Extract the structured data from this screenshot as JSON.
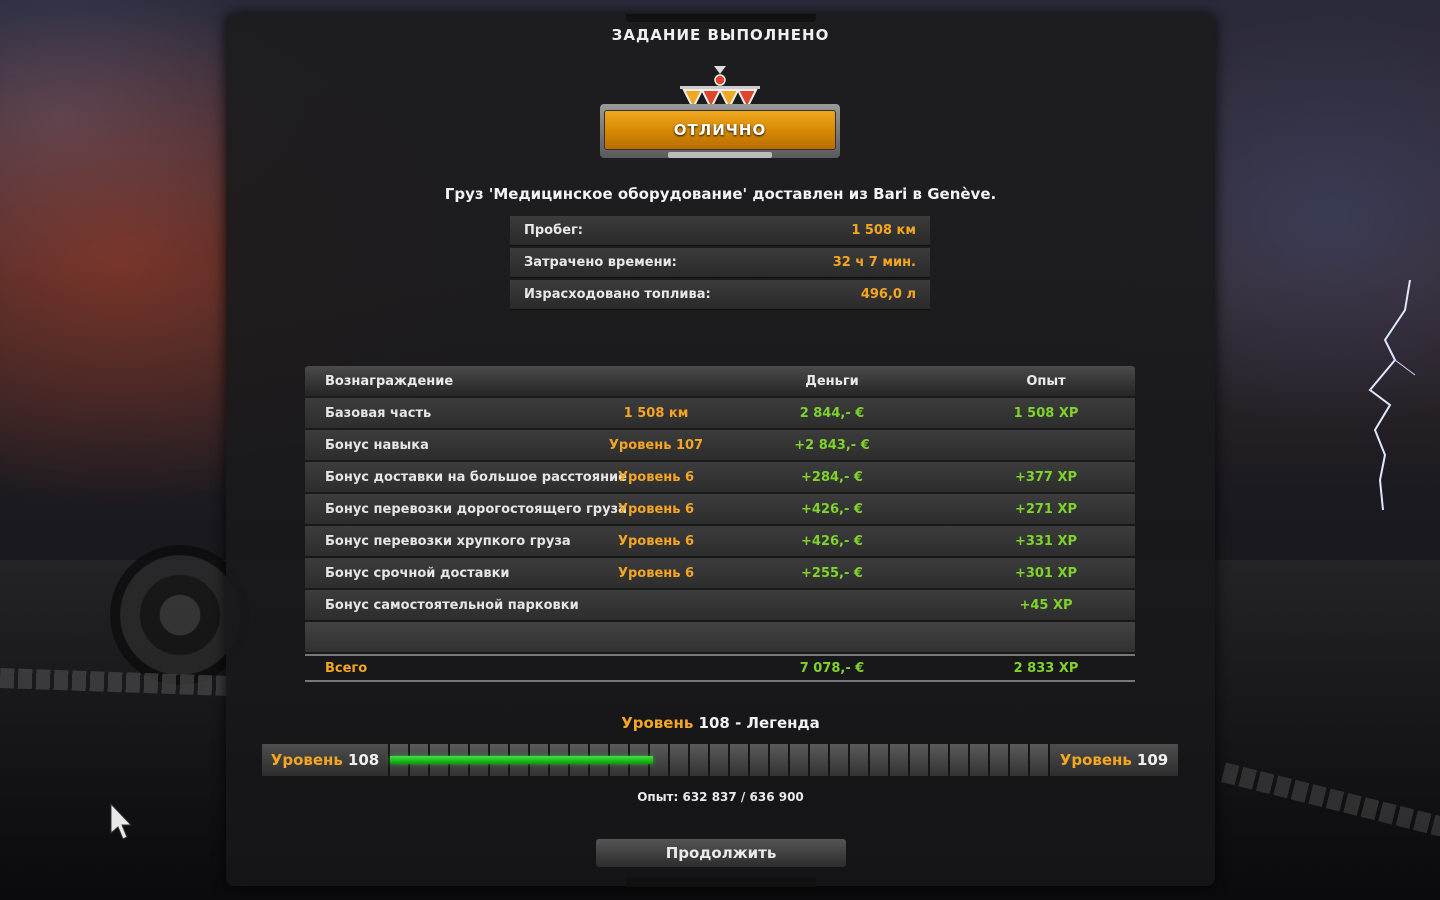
{
  "window": {
    "title": "ЗАДАНИЕ ВЫПОЛНЕНО"
  },
  "rating": {
    "label": "ОТЛИЧНО",
    "color": "#f0a81e"
  },
  "cargo_text": "Груз 'Медицинское оборудование' доставлен из Bari в Genève.",
  "stats": [
    {
      "label": "Пробег:",
      "value": "1 508 км"
    },
    {
      "label": "Затрачено времени:",
      "value": "32 ч 7 мин."
    },
    {
      "label": "Израсходовано топлива:",
      "value": "496,0 л"
    }
  ],
  "rewards": {
    "headers": {
      "name": "Вознаграждение",
      "money": "Деньги",
      "xp": "Опыт"
    },
    "rows": [
      {
        "name": "Базовая часть",
        "mid": "1 508 км",
        "money": "2 844,- €",
        "xp": "1 508 XP"
      },
      {
        "name": "Бонус навыка",
        "mid": "Уровень 107",
        "money": "+2 843,- €",
        "xp": ""
      },
      {
        "name": "Бонус доставки на большое расстояние",
        "mid": "Уровень 6",
        "money": "+284,- €",
        "xp": "+377 XP"
      },
      {
        "name": "Бонус перевозки дорогостоящего груза",
        "mid": "Уровень 6",
        "money": "+426,- €",
        "xp": "+271 XP"
      },
      {
        "name": "Бонус перевозки хрупкого груза",
        "mid": "Уровень 6",
        "money": "+426,- €",
        "xp": "+331 XP"
      },
      {
        "name": "Бонус срочной доставки",
        "mid": "Уровень 6",
        "money": "+255,- €",
        "xp": "+301 XP"
      },
      {
        "name": "Бонус самостоятельной парковки",
        "mid": "",
        "money": "",
        "xp": "+45 XP"
      }
    ],
    "total": {
      "name": "Всего",
      "money": "7 078,- €",
      "xp": "2 833 XP"
    }
  },
  "level": {
    "word": "Уровень",
    "current": "108",
    "title_suffix": "- Легенда",
    "next": "109",
    "progress_fraction": 0.4,
    "segments": 33
  },
  "xp_text": "Опыт: 632 837 / 636 900",
  "continue_label": "Продолжить",
  "icons": [
    "rating-emblem-icon",
    "lightning-icon",
    "mouse-cursor-icon"
  ]
}
